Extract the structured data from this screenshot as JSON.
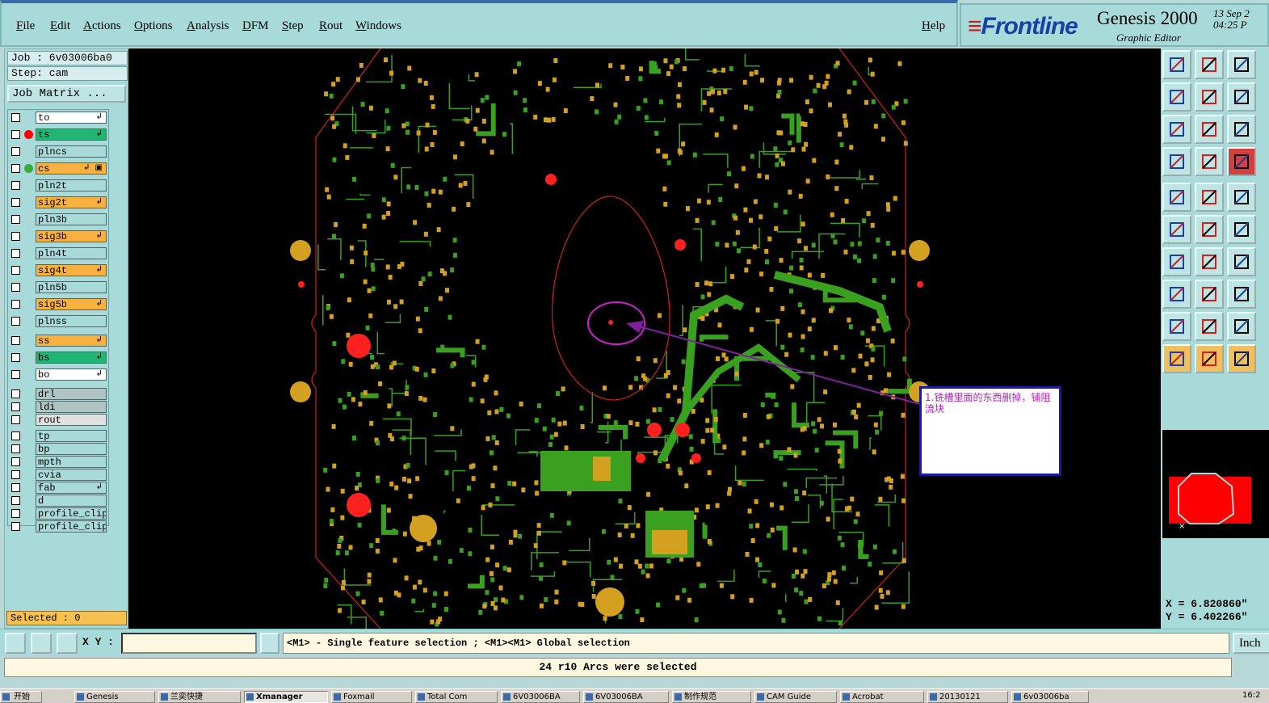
{
  "menu": {
    "items": [
      "File",
      "Edit",
      "Actions",
      "Options",
      "Analysis",
      "DFM",
      "Step",
      "Rout",
      "Windows"
    ],
    "help": "Help"
  },
  "brand": {
    "logo": "Frontline",
    "product": "Genesis 2000",
    "subtitle": "Graphic Editor",
    "date": "13 Sep 2",
    "time": "04:25 P"
  },
  "job": {
    "job_label": "Job : 6v03006ba0",
    "step_label": "Step: cam",
    "matrix_button": "Job Matrix ..."
  },
  "layers": [
    {
      "name": "to",
      "color": "#ffffff",
      "dot": "",
      "flag": "↲"
    },
    {
      "name": "ts",
      "color": "#22b573",
      "dot": "#ff0000",
      "flag": "↲"
    },
    {
      "name": "plncs",
      "color": "#a9dada",
      "dot": "",
      "flag": ""
    },
    {
      "name": "cs",
      "color": "#f8b040",
      "dot": "#3aa83a",
      "flag": "↲ ▣"
    },
    {
      "name": "pln2t",
      "color": "#a9dada",
      "dot": "",
      "flag": ""
    },
    {
      "name": "sig2t",
      "color": "#f8b040",
      "dot": "",
      "flag": "↲"
    },
    {
      "name": "pln3b",
      "color": "#a9dada",
      "dot": "",
      "flag": ""
    },
    {
      "name": "sig3b",
      "color": "#f8b040",
      "dot": "",
      "flag": "↲"
    },
    {
      "name": "pln4t",
      "color": "#a9dada",
      "dot": "",
      "flag": ""
    },
    {
      "name": "sig4t",
      "color": "#f8b040",
      "dot": "",
      "flag": "↲"
    },
    {
      "name": "pln5b",
      "color": "#a9dada",
      "dot": "",
      "flag": ""
    },
    {
      "name": "sig5b",
      "color": "#f8b040",
      "dot": "",
      "flag": "↲"
    },
    {
      "name": "plnss",
      "color": "#a9dada",
      "dot": "",
      "flag": ""
    },
    {
      "name": "ss",
      "color": "#f8b040",
      "dot": "",
      "flag": "↲"
    },
    {
      "name": "bs",
      "color": "#22b573",
      "dot": "",
      "flag": "↲"
    },
    {
      "name": "bo",
      "color": "#ffffff",
      "dot": "",
      "flag": "↲"
    },
    {
      "name": "drl",
      "color": "#b0c4c4",
      "dot": "",
      "flag": ""
    },
    {
      "name": "ldi",
      "color": "#b0c4c4",
      "dot": "",
      "flag": ""
    },
    {
      "name": "rout",
      "color": "#e0e0e0",
      "dot": "",
      "flag": ""
    },
    {
      "name": "tp",
      "color": "#a9dada",
      "dot": "",
      "flag": ""
    },
    {
      "name": "bp",
      "color": "#a9dada",
      "dot": "",
      "flag": ""
    },
    {
      "name": "mpth",
      "color": "#a9dada",
      "dot": "",
      "flag": ""
    },
    {
      "name": "cvia",
      "color": "#a9dada",
      "dot": "",
      "flag": ""
    },
    {
      "name": "fab",
      "color": "#a9dada",
      "dot": "",
      "flag": "↲"
    },
    {
      "name": "d",
      "color": "#a9dada",
      "dot": "",
      "flag": ""
    },
    {
      "name": "profile_clip",
      "color": "#a9dada",
      "dot": "",
      "flag": ""
    },
    {
      "name": "profile_clip",
      "color": "#a9dada",
      "dot": "",
      "flag": ""
    }
  ],
  "selected": "Selected : 0",
  "annotation": "1.铣槽里面的东西删掉，铺阻流块",
  "coords": {
    "x": "X = 6.820860\"",
    "y": "Y = 6.402266\""
  },
  "toolbar_icons": [
    "open-icon",
    "save-icon",
    "home-icon",
    "zoom-back-icon",
    "zoom-forward-icon",
    "zoom-fit-icon",
    "zoom-home-icon",
    "pan-icon",
    "ratio-icon",
    "measure-icon",
    "grid-icon",
    "layer-icon",
    "add-pad-icon",
    "add-line-icon",
    "ruler-icon",
    "connect-icon",
    "cross-icon",
    "move-icon",
    "line-red-icon",
    "line-blue-icon",
    "undo-arc-icon",
    "snap-icon",
    "line-h-icon",
    "box-icon",
    "triangle-icon",
    "triangle2-icon",
    "triangle3-icon",
    "select-icon",
    "select-edit-icon",
    "select-move-icon"
  ],
  "cmdbar": {
    "xy_label": "X Y :",
    "xy_value": "",
    "hint": "<M1> - Single feature selection ; <M1><M1> Global selection",
    "units": "Inch"
  },
  "status": "24 r10 Arcs were selected",
  "taskbar": {
    "start": "开始",
    "tasks": [
      "Genesis",
      "兰奕快捷",
      "Xmanager",
      "Foxmail",
      "Total Com",
      "6V03006BA",
      "6V03006BA",
      "制作规范",
      "CAM Guide",
      "Acrobat",
      "20130121",
      "6v03006ba"
    ],
    "clock": "16:2"
  },
  "colors": {
    "panel": "#a9dada",
    "canvas": "#000000",
    "copper": "#3aa020",
    "pad": "#d4a020",
    "outline": "#d02020",
    "annotation": "#b020c0"
  }
}
